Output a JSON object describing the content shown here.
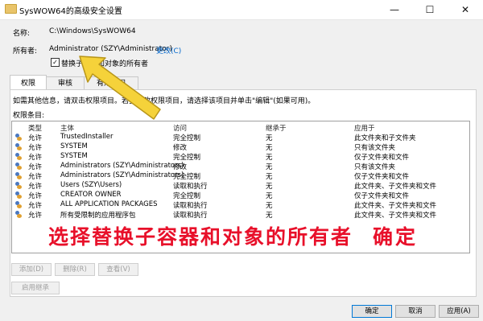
{
  "window": {
    "title": "SysWOW64的高级安全设置",
    "minimize": "—",
    "maximize": "☐",
    "close": "✕"
  },
  "name_label": "名称:",
  "name_value": "C:\\Windows\\SysWOW64",
  "owner_label": "所有者:",
  "owner_value": "Administrator (SZY\\Administrator)",
  "owner_change": "更改(C)",
  "replace_owner_checkbox": {
    "label": "替换子容器和对象的所有者",
    "checked": true
  },
  "tabs": [
    {
      "label": "权限"
    },
    {
      "label": "审核"
    },
    {
      "label": "有效访问"
    }
  ],
  "info_text": "如需其他信息，请双击权限项目。若要修改权限项目，请选择该项目并单击\"编辑\"(如果可用)。",
  "entries_label": "权限条目:",
  "columns": {
    "type": "类型",
    "principal": "主体",
    "access": "访问",
    "inherited": "继承于",
    "applies": "应用于"
  },
  "rows": [
    {
      "type": "允许",
      "principal": "TrustedInstaller",
      "access": "完全控制",
      "inherited": "无",
      "applies": "此文件夹和子文件夹"
    },
    {
      "type": "允许",
      "principal": "SYSTEM",
      "access": "修改",
      "inherited": "无",
      "applies": "只有该文件夹"
    },
    {
      "type": "允许",
      "principal": "SYSTEM",
      "access": "完全控制",
      "inherited": "无",
      "applies": "仅子文件夹和文件"
    },
    {
      "type": "允许",
      "principal": "Administrators (SZY\\Administrators)",
      "access": "修改",
      "inherited": "无",
      "applies": "只有该文件夹"
    },
    {
      "type": "允许",
      "principal": "Administrators (SZY\\Administrators)",
      "access": "完全控制",
      "inherited": "无",
      "applies": "仅子文件夹和文件"
    },
    {
      "type": "允许",
      "principal": "Users (SZY\\Users)",
      "access": "读取和执行",
      "inherited": "无",
      "applies": "此文件夹、子文件夹和文件"
    },
    {
      "type": "允许",
      "principal": "CREATOR OWNER",
      "access": "完全控制",
      "inherited": "无",
      "applies": "仅子文件夹和文件"
    },
    {
      "type": "允许",
      "principal": "ALL APPLICATION PACKAGES",
      "access": "读取和执行",
      "inherited": "无",
      "applies": "此文件夹、子文件夹和文件"
    },
    {
      "type": "允许",
      "principal": "所有受限制的应用程序包",
      "access": "读取和执行",
      "inherited": "无",
      "applies": "此文件夹、子文件夹和文件"
    }
  ],
  "buttons": {
    "add": "添加(D)",
    "remove": "删除(R)",
    "view": "查看(V)",
    "enable_inheritance": "启用继承"
  },
  "overlay_text": "选择替换子容器和对象的所有者",
  "overlay_confirm": "确定",
  "footer": {
    "ok": "确定",
    "cancel": "取消",
    "apply": "应用(A)"
  },
  "colors": {
    "annotation": "#e8102a",
    "arrow": "#f5d23a",
    "link": "#0066cc"
  }
}
